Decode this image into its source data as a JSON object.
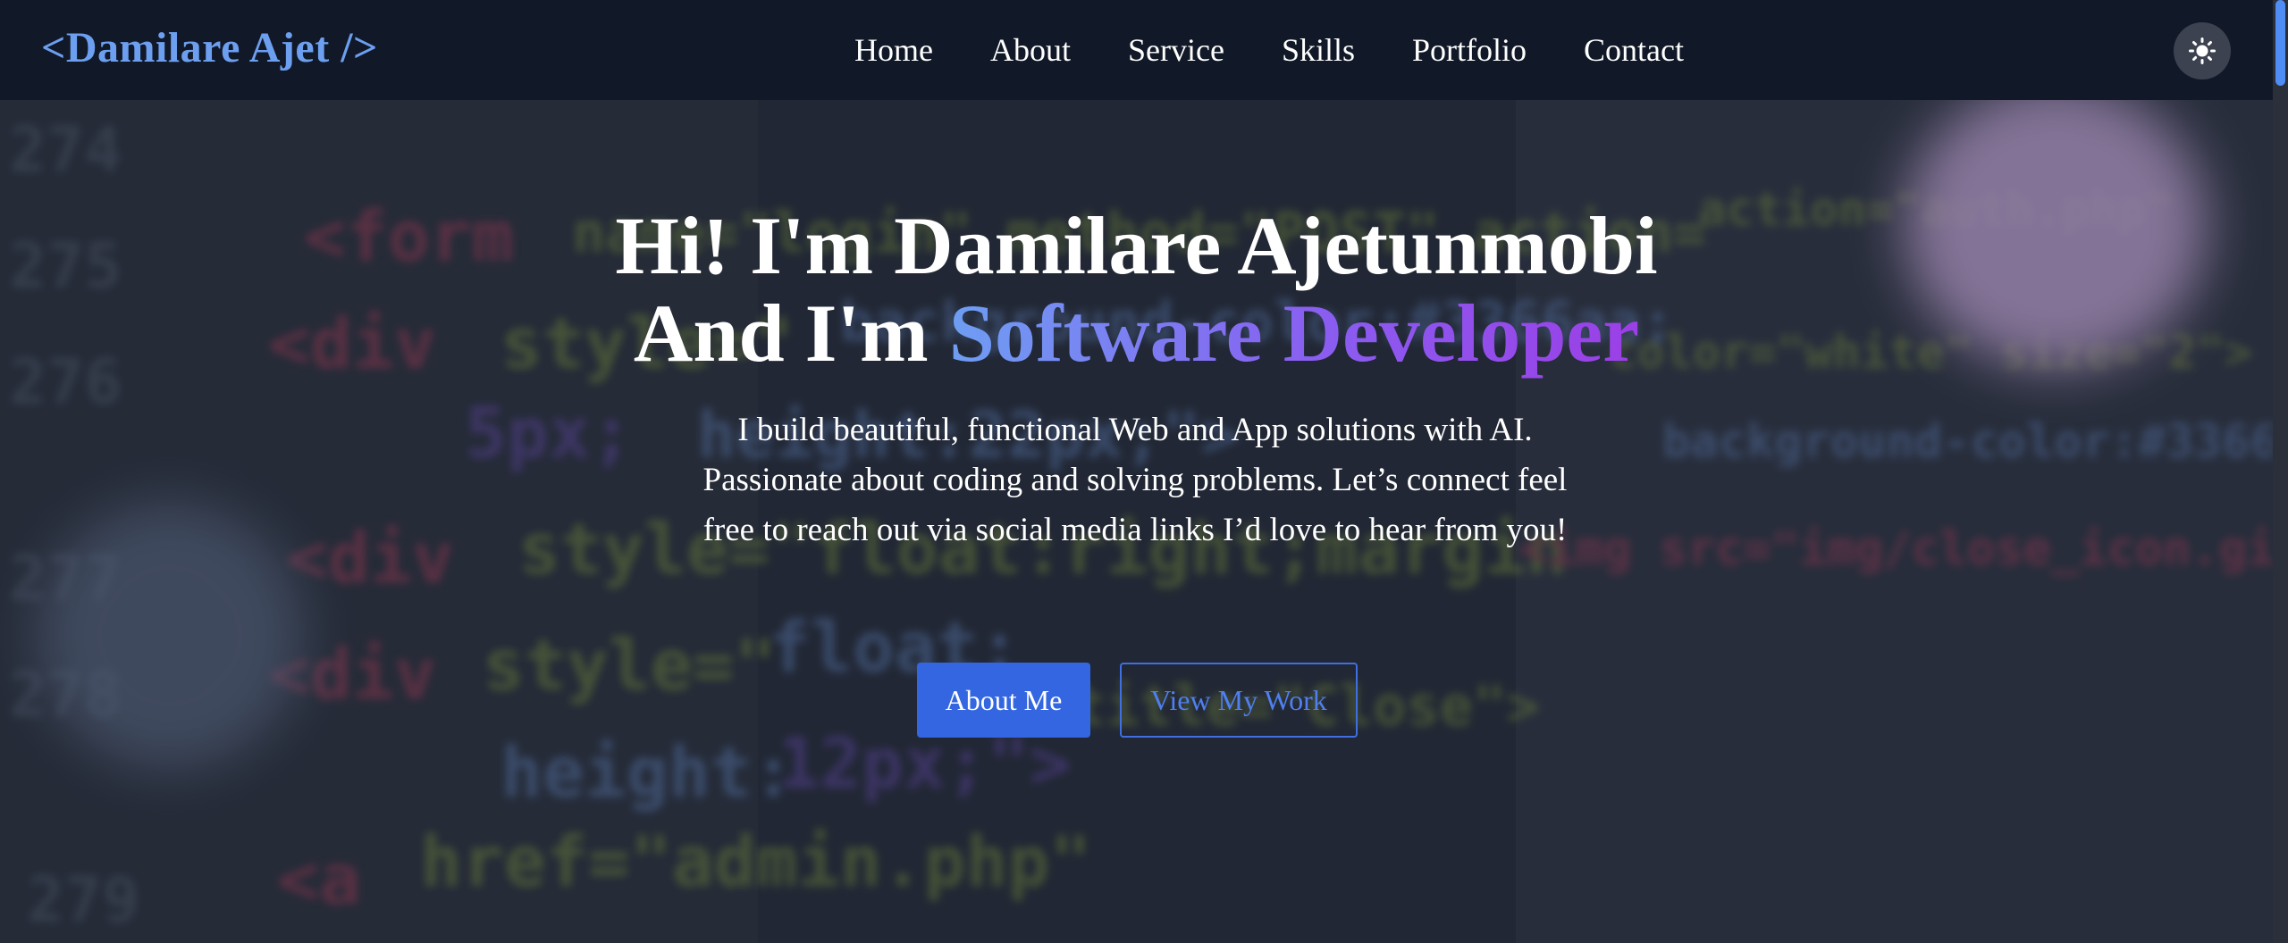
{
  "header": {
    "logo": "<Damilare Ajet />",
    "nav": [
      {
        "label": "Home"
      },
      {
        "label": "About"
      },
      {
        "label": "Service"
      },
      {
        "label": "Skills"
      },
      {
        "label": "Portfolio"
      },
      {
        "label": "Contact"
      }
    ],
    "theme_toggle_icon": "sun-icon"
  },
  "hero": {
    "title_line1": "Hi! I'm Damilare Ajetunmobi",
    "title_line2_prefix": "And I'm ",
    "title_line2_highlight": "Software Developer",
    "description": "I build beautiful, functional Web and App solutions with AI. Passionate about coding and solving problems. Let’s connect feel free to reach out via social media links I’d love to hear from you!",
    "primary_button": "About Me",
    "secondary_button": "View My Work"
  },
  "colors": {
    "logo": "#6c9ff0",
    "navbar_bg": "#111827",
    "primary_button_bg": "#3366e0",
    "outline_button": "#3f6fe0",
    "gradient_start": "#6e9ef3",
    "gradient_end": "#9b3fe6"
  }
}
